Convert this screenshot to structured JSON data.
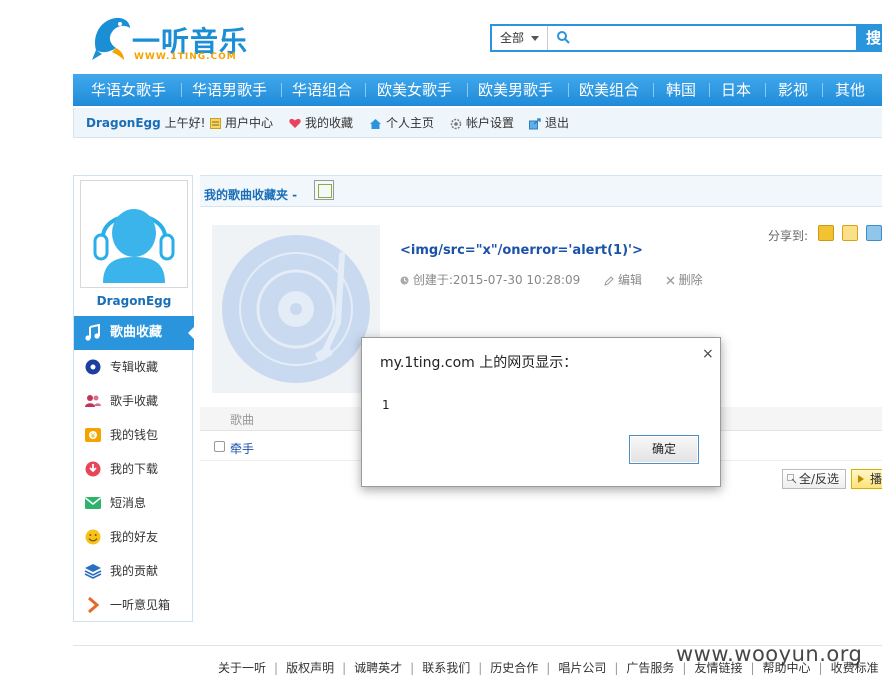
{
  "header": {
    "logo_text": "一听音乐",
    "logo_url": "WWW.1TING.COM",
    "search": {
      "scope": "全部",
      "value": "",
      "button_label": "搜"
    }
  },
  "nav": {
    "items": [
      {
        "label": "华语女歌手"
      },
      {
        "label": "华语男歌手"
      },
      {
        "label": "华语组合"
      },
      {
        "label": "欧美女歌手"
      },
      {
        "label": "欧美男歌手"
      },
      {
        "label": "欧美组合"
      },
      {
        "label": "韩国"
      },
      {
        "label": "日本"
      },
      {
        "label": "影视"
      },
      {
        "label": "其他"
      }
    ]
  },
  "subnav": {
    "username": "DragonEgg",
    "greeting": "上午好!",
    "items": [
      {
        "label": "用户中心"
      },
      {
        "label": "我的收藏"
      },
      {
        "label": "个人主页"
      },
      {
        "label": "帐户设置"
      },
      {
        "label": "退出"
      }
    ]
  },
  "sidebar": {
    "username": "DragonEgg",
    "items": [
      {
        "label": "歌曲收藏",
        "active": true
      },
      {
        "label": "专辑收藏"
      },
      {
        "label": "歌手收藏"
      },
      {
        "label": "我的钱包"
      },
      {
        "label": "我的下载"
      },
      {
        "label": "短消息"
      },
      {
        "label": "我的好友"
      },
      {
        "label": "我的贡献"
      },
      {
        "label": "一听意见箱"
      }
    ]
  },
  "main": {
    "title": "我的歌曲收藏夹 -",
    "song_title": "<img/src=\"x\"/onerror='alert(1)'>",
    "created": "创建于:2015-07-30 10:28:09",
    "edit_label": "编辑",
    "delete_label": "删除",
    "share_label": "分享到:",
    "list_header": "歌曲",
    "songs": [
      {
        "name": "牵手"
      }
    ],
    "select_all_label": "全/反选",
    "play_label": "播"
  },
  "dialog": {
    "title": "my.1ting.com 上的网页显示：",
    "close": "×",
    "message": "1",
    "ok_label": "确定"
  },
  "footer": {
    "links": [
      "关于一听",
      "版权声明",
      "诚聘英才",
      "联系我们",
      "历史合作",
      "唱片公司",
      "广告服务",
      "友情链接",
      "帮助中心",
      "收费标准"
    ]
  },
  "watermark": "www.wooyun.org",
  "colors": {
    "accent": "#2a95dc",
    "link": "#1a52a8",
    "logo_orange": "#f5a300"
  }
}
